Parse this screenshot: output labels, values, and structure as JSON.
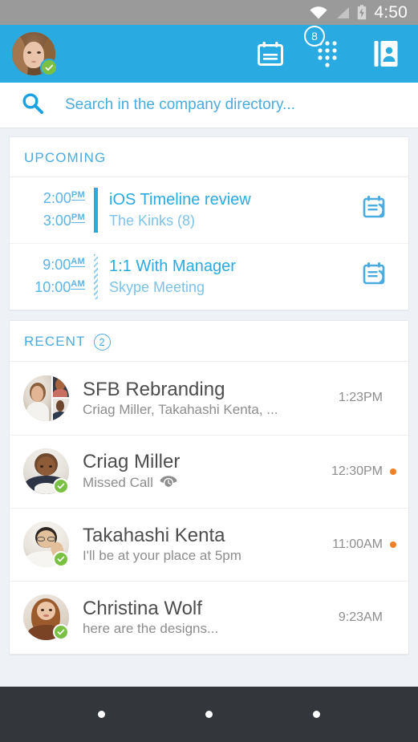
{
  "status_bar": {
    "time": "4:50",
    "icons": [
      "wifi-icon",
      "cellular-signal-icon",
      "battery-charging-icon"
    ],
    "background": "#9a9a9a"
  },
  "app_bar": {
    "background": "#29abe2",
    "avatar": {
      "name": "user-avatar",
      "presence": "available",
      "presence_color": "#7ac143"
    },
    "actions": [
      {
        "name": "calendar-button",
        "icon": "calendar-icon",
        "badge": null
      },
      {
        "name": "dialpad-button",
        "icon": "dialpad-icon",
        "badge": "8"
      },
      {
        "name": "contacts-button",
        "icon": "address-book-icon",
        "badge": null
      }
    ]
  },
  "search": {
    "icon": "search-icon",
    "placeholder": "Search in the company directory...",
    "value": "",
    "color": "#4aabe0"
  },
  "upcoming": {
    "title": "UPCOMING",
    "meetings": [
      {
        "start_time": "2:00",
        "start_meridiem": "PM",
        "end_time": "3:00",
        "end_meridiem": "PM",
        "title": "iOS Timeline review",
        "subtitle": "The Kinks (8)",
        "status": "busy",
        "action_icon": "join-meeting-icon"
      },
      {
        "start_time": "9:00",
        "start_meridiem": "AM",
        "end_time": "10:00",
        "end_meridiem": "AM",
        "title": "1:1 With Manager",
        "subtitle": "Skype Meeting",
        "status": "tentative",
        "action_icon": "join-meeting-icon"
      }
    ]
  },
  "recent": {
    "title": "RECENT",
    "count": "2",
    "conversations": [
      {
        "name": "SFB Rebranding",
        "message": "Criag Miller, Takahashi Kenta, ...",
        "time": "1:23PM",
        "unread": false,
        "avatar_type": "group",
        "presence": null,
        "message_icon": null
      },
      {
        "name": "Criag Miller",
        "message": "Missed Call",
        "time": "12:30PM",
        "unread": true,
        "avatar_type": "person",
        "presence": "available",
        "message_icon": "missed-call-icon"
      },
      {
        "name": "Takahashi Kenta",
        "message": "I'll be at your place at 5pm",
        "time": "11:00AM",
        "unread": true,
        "avatar_type": "person",
        "presence": "available",
        "message_icon": null
      },
      {
        "name": "Christina Wolf",
        "message": "here are the designs...",
        "time": "9:23AM",
        "unread": false,
        "avatar_type": "person",
        "presence": "available",
        "message_icon": null
      }
    ]
  },
  "nav_bar": {
    "background": "#33363a",
    "buttons": [
      {
        "name": "back-button",
        "icon": "dot-icon"
      },
      {
        "name": "home-button",
        "icon": "dot-icon"
      },
      {
        "name": "recents-button",
        "icon": "dot-icon"
      }
    ]
  },
  "colors": {
    "accent": "#29abe2",
    "accent_light": "#4aabe0",
    "unread": "#f08024",
    "presence_available": "#7ac143",
    "page_background": "#eef2f6"
  }
}
